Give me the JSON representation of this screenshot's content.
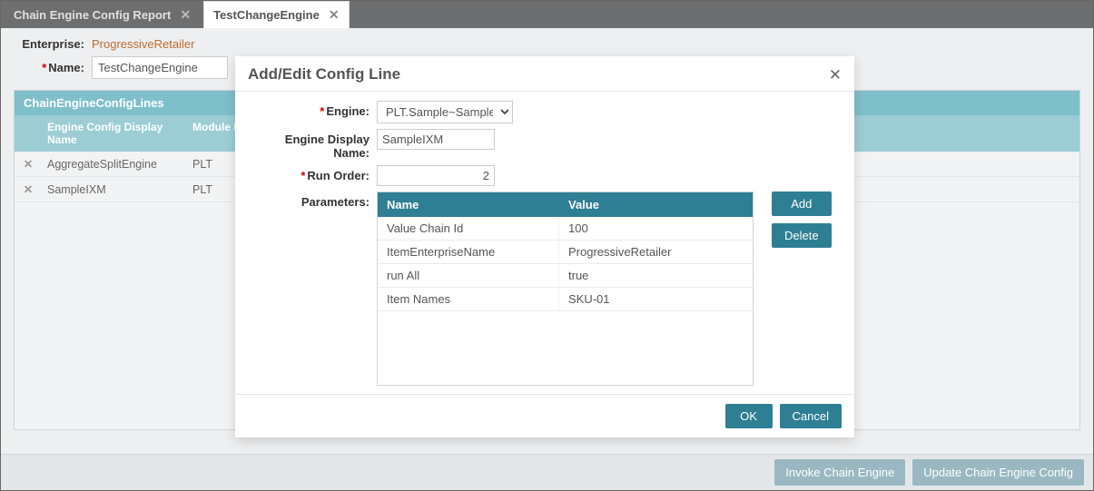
{
  "tabs": [
    {
      "label": "Chain Engine Config Report",
      "active": false
    },
    {
      "label": "TestChangeEngine",
      "active": true
    }
  ],
  "page": {
    "enterprise_label": "Enterprise:",
    "enterprise_value": "ProgressiveRetailer",
    "name_label": "Name:",
    "name_value": "TestChangeEngine",
    "section_title": "ChainEngineConfigLines",
    "columns": {
      "display_name": "Engine Config Display Name",
      "module_prefix": "Module Pr"
    },
    "rows": [
      {
        "display_name": "AggregateSplitEngine",
        "module_prefix": "PLT"
      },
      {
        "display_name": "SampleIXM",
        "module_prefix": "PLT"
      }
    ]
  },
  "bottom": {
    "invoke": "Invoke Chain Engine",
    "update": "Update Chain Engine Config"
  },
  "dialog": {
    "title": "Add/Edit Config Line",
    "labels": {
      "engine": "Engine:",
      "display_name": "Engine Display Name:",
      "run_order": "Run Order:",
      "parameters": "Parameters:"
    },
    "engine_value": "PLT.Sample~SampleCo",
    "display_name_value": "SampleIXM",
    "run_order_value": "2",
    "params_header": {
      "name": "Name",
      "value": "Value"
    },
    "params": [
      {
        "name": "Value Chain Id",
        "value": "100"
      },
      {
        "name": "ItemEnterpriseName",
        "value": "ProgressiveRetailer"
      },
      {
        "name": "run All",
        "value": "true"
      },
      {
        "name": "Item Names",
        "value": "SKU-01"
      }
    ],
    "buttons": {
      "add": "Add",
      "delete": "Delete",
      "ok": "OK",
      "cancel": "Cancel"
    }
  }
}
